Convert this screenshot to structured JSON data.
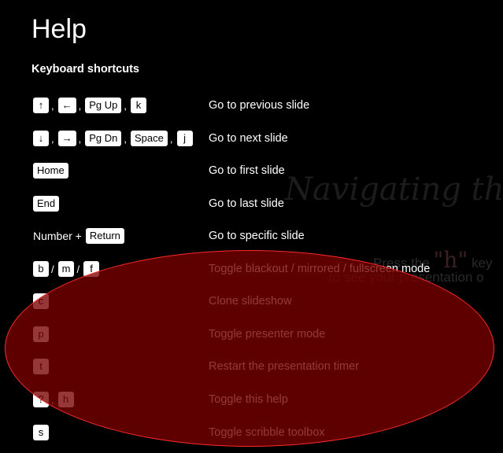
{
  "background_slide": {
    "title": "Navigating the",
    "hint_prefix": "Press the",
    "hint_key": "\"h\"",
    "hint_suffix": "key",
    "hint_line2": "to see your presentation o"
  },
  "help": {
    "title": "Help",
    "subtitle": "Keyboard shortcuts",
    "shortcuts": [
      {
        "keys": [
          "↑",
          "←",
          "Pg Up",
          "k"
        ],
        "separator": ",",
        "description": "Go to previous slide"
      },
      {
        "keys": [
          "↓",
          "→",
          "Pg Dn",
          "Space",
          "j"
        ],
        "separator": ",",
        "description": "Go to next slide"
      },
      {
        "keys": [
          "Home"
        ],
        "description": "Go to first slide"
      },
      {
        "keys": [
          "End"
        ],
        "description": "Go to last slide"
      },
      {
        "prefix": "Number +",
        "keys": [
          "Return"
        ],
        "description": "Go to specific slide"
      },
      {
        "keys": [
          "b",
          "m",
          "f"
        ],
        "separator": "/",
        "description": "Toggle blackout / mirrored / fullscreen mode"
      },
      {
        "keys": [
          "c"
        ],
        "description": "Clone slideshow"
      },
      {
        "keys": [
          "p"
        ],
        "description": "Toggle presenter mode"
      },
      {
        "keys": [
          "t"
        ],
        "description": "Restart the presentation timer"
      },
      {
        "keys": [
          "?",
          "h"
        ],
        "separator": ",",
        "description": "Toggle this help"
      },
      {
        "keys": [
          "s"
        ],
        "description": "Toggle scribble toolbox"
      }
    ]
  },
  "colors": {
    "background": "#000000",
    "text": "#ffffff",
    "key_background": "#ffffff",
    "annotation_fill": "#780000",
    "annotation_stroke": "#ff2a2a"
  }
}
